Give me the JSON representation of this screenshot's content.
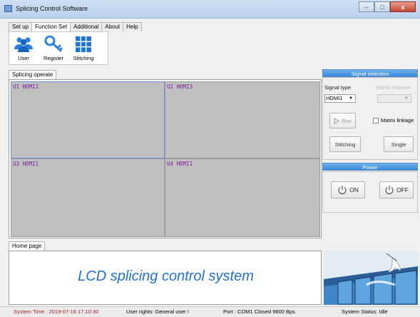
{
  "window": {
    "title": "Splicing Control Software",
    "close_glyph": "x",
    "minimize_glyph": "–",
    "maximize_glyph": "□"
  },
  "menu": {
    "tabs": [
      "Set up",
      "Function Set",
      "Additional",
      "About",
      "Help"
    ],
    "active": "Function Set"
  },
  "toolbar": {
    "items": [
      {
        "label": "User",
        "icon": "users-icon"
      },
      {
        "label": "Register",
        "icon": "key-icon"
      },
      {
        "label": "Stitching",
        "icon": "grid-icon"
      }
    ]
  },
  "splicing": {
    "tab_label": "Splicing operate",
    "cells": [
      {
        "label": "U1 HDMI1"
      },
      {
        "label": "U2 HDMI3"
      },
      {
        "label": "U3 HDMI1"
      },
      {
        "label": "U4 HDMI1"
      }
    ]
  },
  "signal": {
    "header": "Signal selection",
    "type_label": "Signal type",
    "matrix_label": "Matrix channel",
    "selected": "HDMI1",
    "run_label": "Run",
    "matrix_linkage_label": "Matrix linkage",
    "matrix_linkage_checked": false,
    "stitching_label": "Stitching",
    "single_label": "Single"
  },
  "power": {
    "header": "Power",
    "on_label": "ON",
    "off_label": "OFF"
  },
  "home": {
    "tab_label": "Home page",
    "banner": "LCD splicing control system"
  },
  "status": {
    "time": "System Time : 2019-07-16 17:10:30",
    "rights": "User rights: General user !",
    "port": "Port : COM1 Closed  9600 Bps",
    "system_status": "System Status: Idle"
  },
  "colors": {
    "accent": "#3a8ad8",
    "banner_text": "#1f6fd0",
    "cell_label": "#7a1a9a",
    "time_text": "#a02020"
  }
}
